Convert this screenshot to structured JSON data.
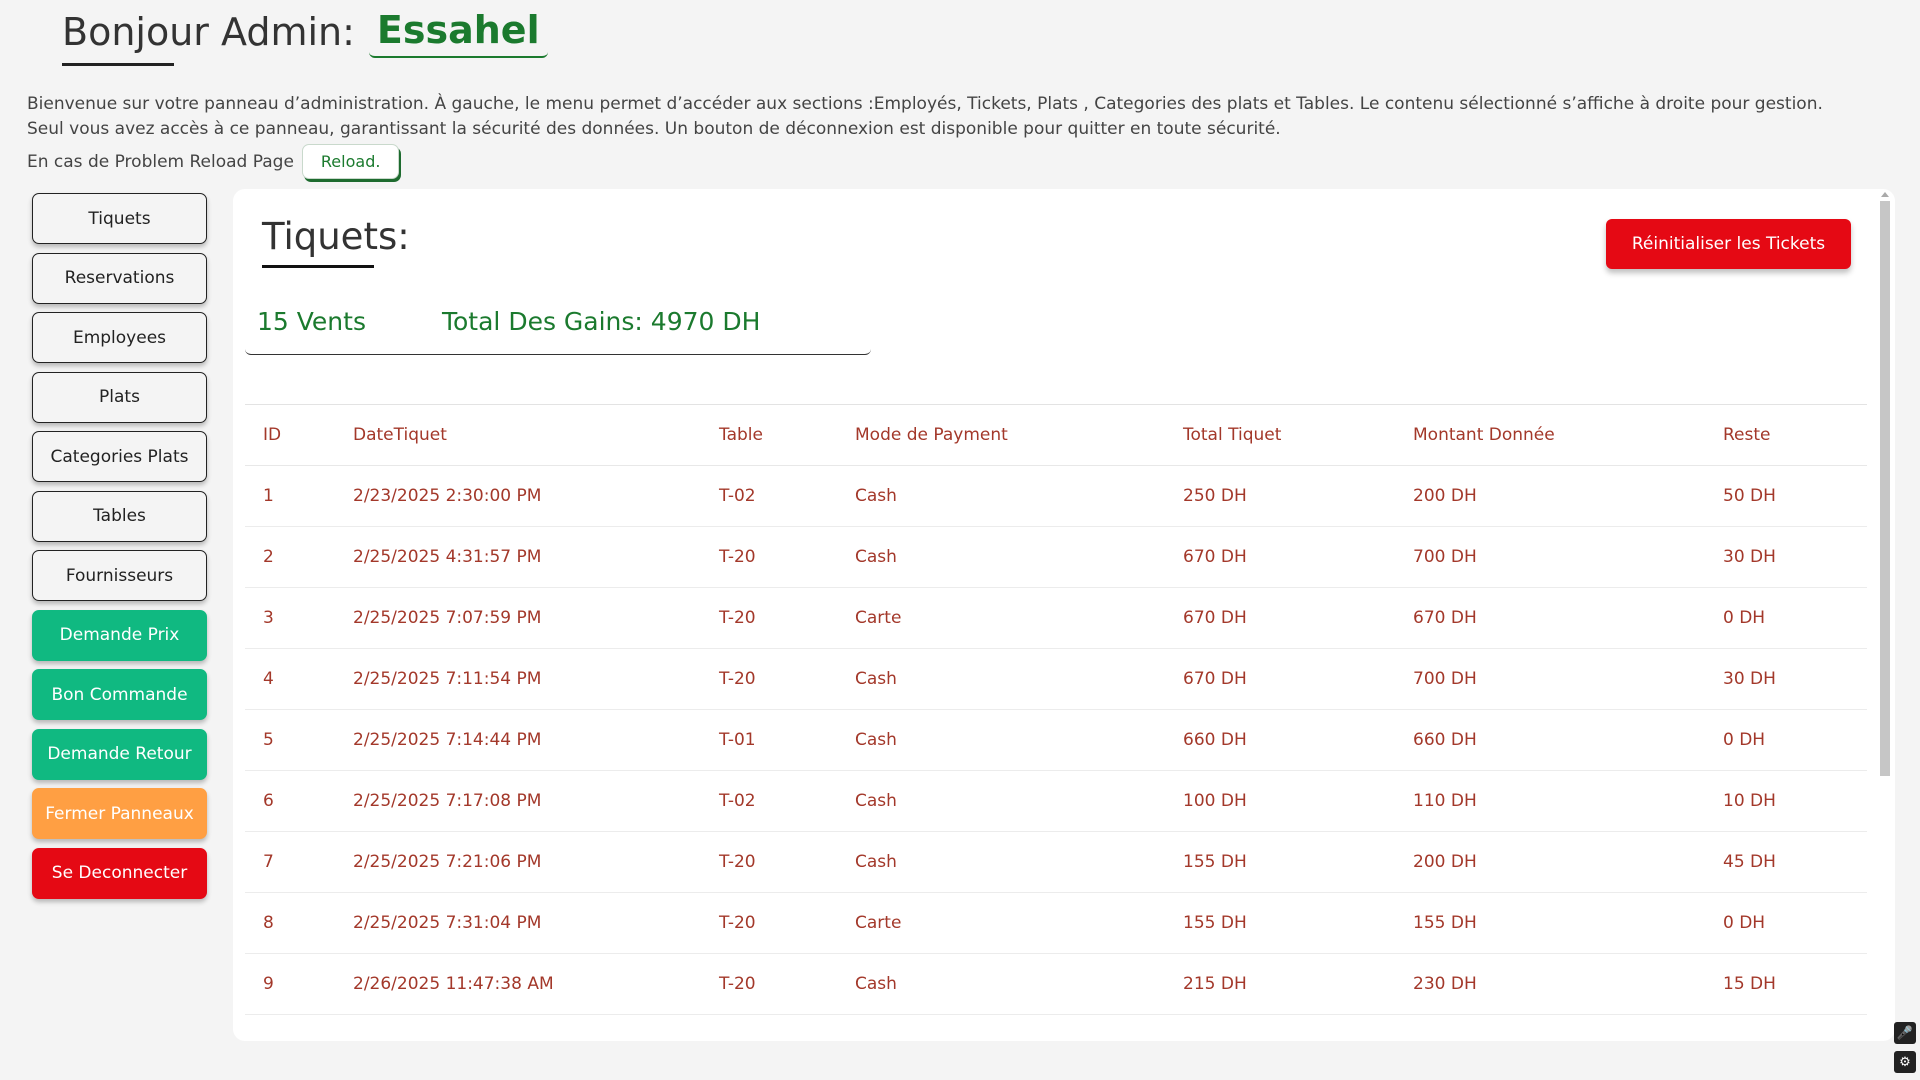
{
  "header": {
    "greeting": "Bonjour Admin:",
    "name": "Essahel"
  },
  "intro": {
    "line1": "Bienvenue sur votre panneau d’administration. À gauche, le menu permet d’accéder aux sections :Employés, Tickets, Plats , Categories des plats et Tables. Le contenu sélectionné s’affiche à droite pour gestion.",
    "line2": "Seul vous avez accès à ce panneau, garantissant la sécurité des données. Un bouton de déconnexion est disponible pour quitter en toute sécurité.",
    "reload_text": "En cas de Problem Reload Page",
    "reload_button": "Reload."
  },
  "sidebar": {
    "items": [
      {
        "label": "Tiquets"
      },
      {
        "label": "Reservations"
      },
      {
        "label": "Employees"
      },
      {
        "label": "Plats"
      },
      {
        "label": "Categories Plats"
      },
      {
        "label": "Tables"
      },
      {
        "label": "Fournisseurs"
      },
      {
        "label": "Demande Prix"
      },
      {
        "label": "Bon Commande"
      },
      {
        "label": "Demande Retour"
      },
      {
        "label": "Fermer Panneaux"
      },
      {
        "label": "Se Deconnecter"
      }
    ]
  },
  "panel": {
    "title": "Tiquets:",
    "reset_button": "Réinitialiser les Tickets",
    "ventes": "15 Vents",
    "gains": "Total Des Gains: 4970 DH"
  },
  "table": {
    "headers": [
      "ID",
      "DateTiquet",
      "Table",
      "Mode de Payment",
      "Total Tiquet",
      "Montant Donnée",
      "Reste"
    ],
    "rows": [
      [
        "1",
        "2/23/2025 2:30:00 PM",
        "T-02",
        "Cash",
        "250 DH",
        "200 DH",
        "50 DH"
      ],
      [
        "2",
        "2/25/2025 4:31:57 PM",
        "T-20",
        "Cash",
        "670 DH",
        "700 DH",
        "30 DH"
      ],
      [
        "3",
        "2/25/2025 7:07:59 PM",
        "T-20",
        "Carte",
        "670 DH",
        "670 DH",
        "0 DH"
      ],
      [
        "4",
        "2/25/2025 7:11:54 PM",
        "T-20",
        "Cash",
        "670 DH",
        "700 DH",
        "30 DH"
      ],
      [
        "5",
        "2/25/2025 7:14:44 PM",
        "T-01",
        "Cash",
        "660 DH",
        "660 DH",
        "0 DH"
      ],
      [
        "6",
        "2/25/2025 7:17:08 PM",
        "T-02",
        "Cash",
        "100 DH",
        "110 DH",
        "10 DH"
      ],
      [
        "7",
        "2/25/2025 7:21:06 PM",
        "T-20",
        "Cash",
        "155 DH",
        "200 DH",
        "45 DH"
      ],
      [
        "8",
        "2/25/2025 7:31:04 PM",
        "T-20",
        "Carte",
        "155 DH",
        "155 DH",
        "0 DH"
      ],
      [
        "9",
        "2/26/2025 11:47:38 AM",
        "T-20",
        "Cash",
        "215 DH",
        "230 DH",
        "15 DH"
      ]
    ]
  },
  "colors": {
    "accent_green": "#1b7a2e",
    "teal": "#10b981",
    "orange": "#ff9f43",
    "red": "#e50914",
    "table_text": "#a3382a"
  },
  "icons": [
    "microphone-icon",
    "settings-icon"
  ]
}
